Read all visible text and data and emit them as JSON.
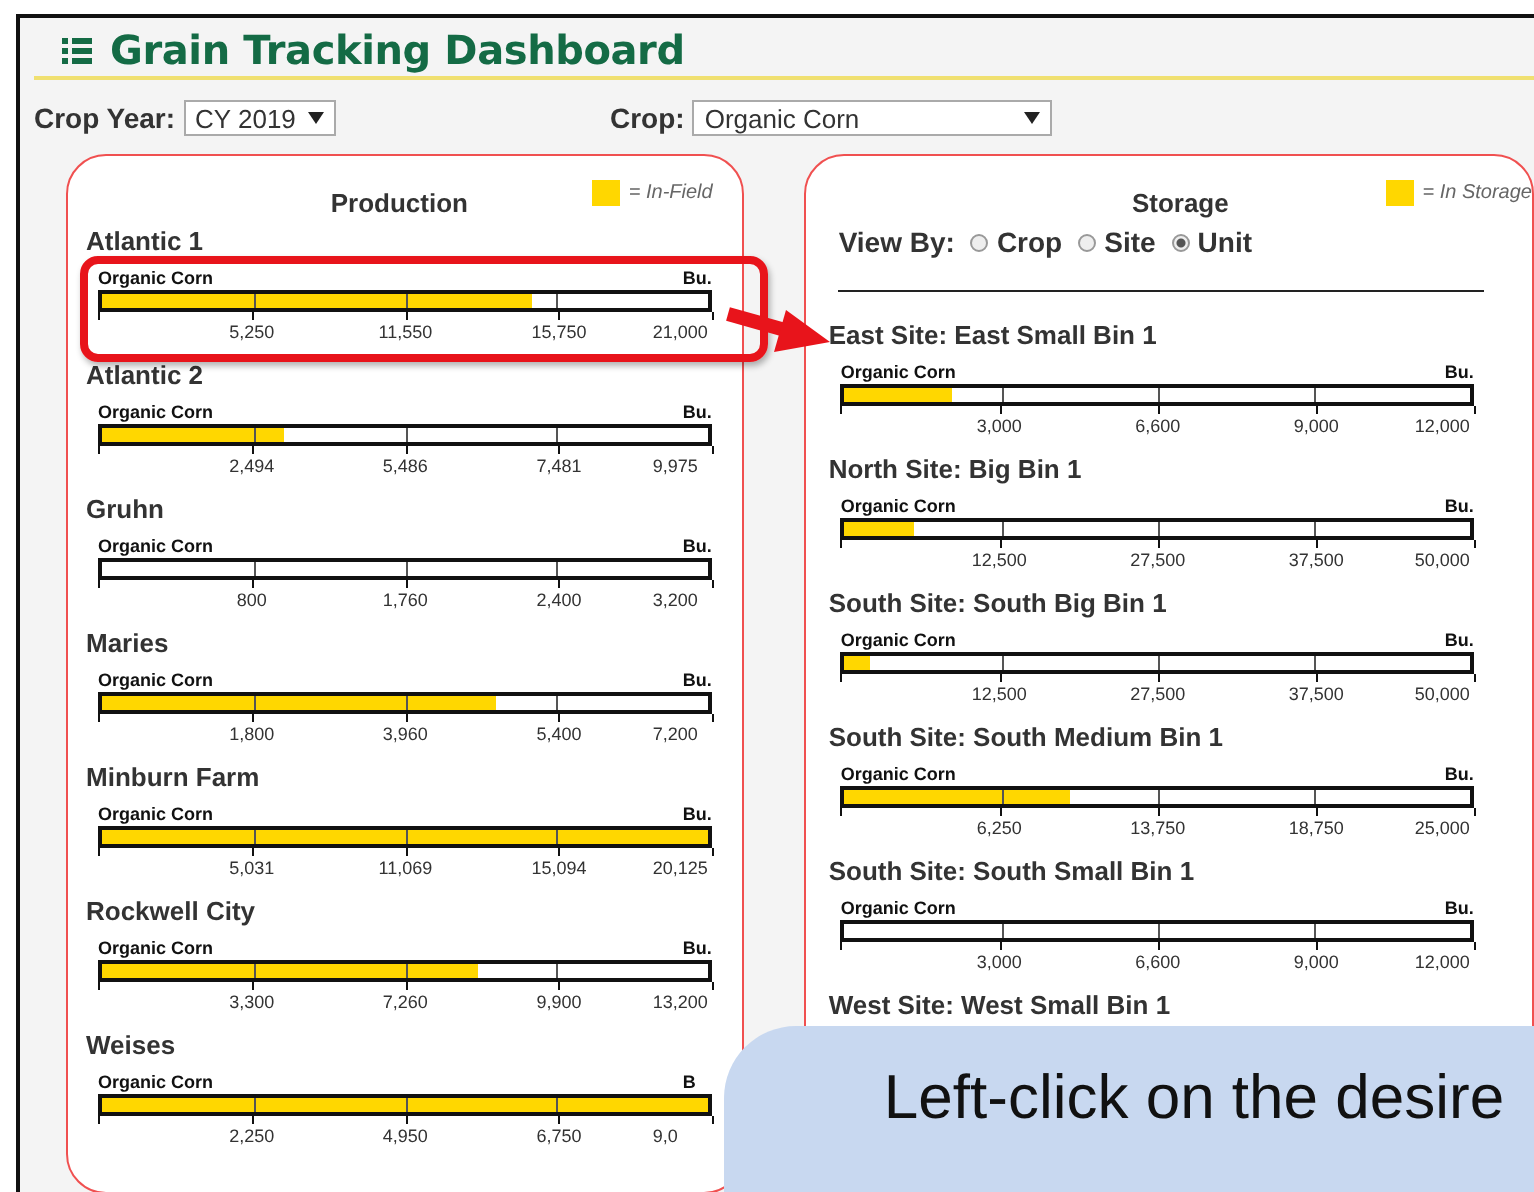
{
  "title": "Grain Tracking Dashboard",
  "filters": [
    {
      "label": "Crop Year:",
      "value": "CY 2019"
    },
    {
      "label": "Crop:",
      "value": "Organic Corn"
    }
  ],
  "production": {
    "title": "Production",
    "legend": "= In-Field",
    "rows": [
      {
        "name": "Atlantic 1",
        "crop": "Organic Corn",
        "unit": "Bu.",
        "level": 0.71,
        "ticks": [
          "5,250",
          "11,550",
          "15,750",
          "21,000"
        ]
      },
      {
        "name": "Atlantic 2",
        "crop": "Organic Corn",
        "unit": "Bu.",
        "level": 0.3,
        "ticks": [
          "2,494",
          "5,486",
          "7,481",
          "9,975"
        ]
      },
      {
        "name": "Gruhn",
        "crop": "Organic Corn",
        "unit": "Bu.",
        "ticks": [
          "800",
          "1,760",
          "2,400",
          "3,200"
        ]
      },
      {
        "name": "Maries",
        "crop": "Organic Corn",
        "unit": "Bu.",
        "level": 0.65,
        "ticks": [
          "1,800",
          "3,960",
          "5,400",
          "7,200"
        ]
      },
      {
        "name": "Minburn Farm",
        "crop": "Organic Corn",
        "unit": "Bu.",
        "level": 1,
        "ticks": [
          "5,031",
          "11,069",
          "15,094",
          "20,125"
        ]
      },
      {
        "name": "Rockwell City",
        "crop": "Organic Corn",
        "unit": "Bu.",
        "level": 0.62,
        "ticks": [
          "3,300",
          "7,260",
          "9,900",
          "13,200"
        ]
      },
      {
        "name": "Weises",
        "crop": "Organic Corn",
        "unit": "B",
        "level": 1,
        "ticks": [
          "2,250",
          "4,950",
          "6,750",
          "9,0"
        ]
      }
    ]
  },
  "storage": {
    "title": "Storage",
    "legend": "= In Storage",
    "view_by": {
      "label": "View By:",
      "options": [
        {
          "label": "Crop",
          "selected": false
        },
        {
          "label": "Site",
          "selected": false
        },
        {
          "label": "Unit",
          "selected": true
        }
      ]
    },
    "rows": [
      {
        "name": "East Site: East Small Bin 1",
        "crop": "Organic Corn",
        "unit": "Bu.",
        "level": 0.17,
        "ticks": [
          "3,000",
          "6,600",
          "9,000",
          "12,000"
        ]
      },
      {
        "name": "North Site: Big Bin 1",
        "crop": "Organic Corn",
        "unit": "Bu.",
        "level": 0.11,
        "ticks": [
          "12,500",
          "27,500",
          "37,500",
          "50,000"
        ]
      },
      {
        "name": "South Site: South Big Bin 1",
        "crop": "Organic Corn",
        "unit": "Bu.",
        "level": 0.04,
        "ticks": [
          "12,500",
          "27,500",
          "37,500",
          "50,000"
        ]
      },
      {
        "name": "South Site: South Medium Bin 1",
        "crop": "Organic Corn",
        "unit": "Bu.",
        "level": 0.36,
        "ticks": [
          "6,250",
          "13,750",
          "18,750",
          "25,000"
        ]
      },
      {
        "name": "South Site: South Small Bin 1",
        "crop": "Organic Corn",
        "unit": "Bu.",
        "ticks": [
          "3,000",
          "6,600",
          "9,000",
          "12,000"
        ]
      },
      {
        "name": "West Site: West Small Bin 1"
      }
    ]
  },
  "callout": {
    "lines": [
      "Left-click on the desire"
    ]
  }
}
